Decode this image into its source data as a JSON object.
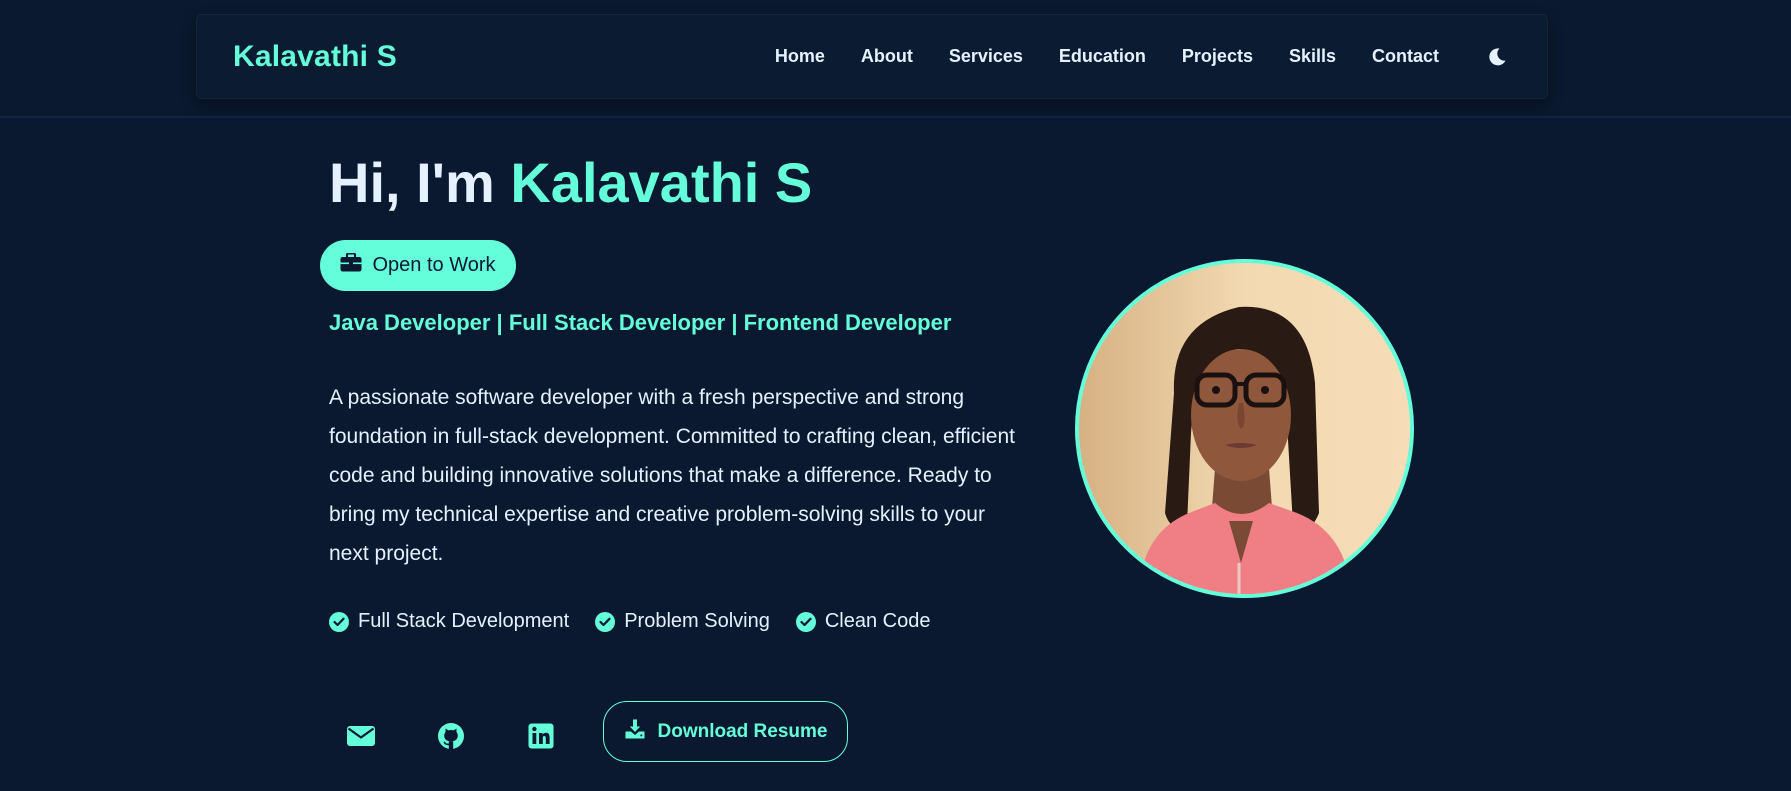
{
  "header": {
    "brand": "Kalavathi S",
    "nav": [
      "Home",
      "About",
      "Services",
      "Education",
      "Projects",
      "Skills",
      "Contact"
    ],
    "theme_icon": "moon-icon"
  },
  "hero": {
    "greeting": "Hi, I'm",
    "name": "Kalavathi S",
    "status": "Open to Work",
    "status_icon": "briefcase-icon",
    "roles": "Java Developer | Full Stack Developer | Frontend Developer",
    "bio": "A passionate software developer with a fresh perspective and strong foundation in full-stack development. Committed to crafting clean, efficient code and building innovative solutions that make a difference. Ready to bring my technical expertise and creative problem-solving skills to your next project.",
    "highlights": [
      "Full Stack Development",
      "Problem Solving",
      "Clean Code"
    ],
    "socials": [
      "envelope-icon",
      "github-icon",
      "linkedin-icon"
    ],
    "resume_label": "Download Resume",
    "resume_icon": "download-icon"
  },
  "colors": {
    "background": "#0a192f",
    "accent": "#64ffda",
    "text": "#e6f1ff"
  }
}
